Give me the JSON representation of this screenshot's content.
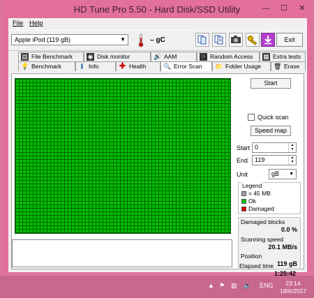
{
  "window": {
    "title": "HD Tune Pro 5.50 - Hard Disk/SSD Utility",
    "minimize": "—",
    "maximize": "☐",
    "close": "✕"
  },
  "menu": {
    "file": "File",
    "help": "Help"
  },
  "toolbar": {
    "drive": "Apple   iPod (119 gB)",
    "temperature": "– gC",
    "exit_label": "Exit"
  },
  "tabs": {
    "row1": [
      {
        "label": "File Benchmark",
        "icon": "file-benchmark-icon"
      },
      {
        "label": "Disk monitor",
        "icon": "disk-monitor-icon"
      },
      {
        "label": "AAM",
        "icon": "speaker-icon"
      },
      {
        "label": "Random Access",
        "icon": "random-access-icon"
      },
      {
        "label": "Extra tests",
        "icon": "extra-tests-icon"
      }
    ],
    "row2": [
      {
        "label": "Benchmark",
        "icon": "benchmark-icon"
      },
      {
        "label": "Info",
        "icon": "info-icon"
      },
      {
        "label": "Health",
        "icon": "health-cross-icon"
      },
      {
        "label": "Error Scan",
        "icon": "magnifier-icon"
      },
      {
        "label": "Folder Usage",
        "icon": "folder-icon"
      },
      {
        "label": "Erase",
        "icon": "trash-icon"
      }
    ]
  },
  "scan": {
    "start_button": "Start",
    "quick_scan": "Quick scan",
    "speed_map": "Speed map",
    "start_label": "Start",
    "start_value": "0",
    "end_label": "End",
    "end_value": "119",
    "unit_label": "Unit",
    "unit_value": "gB",
    "legend_title": "Legend",
    "legend_block": "= 45 MB",
    "legend_ok": "Ok",
    "legend_damaged": "Damaged",
    "ok_color": "#00c000",
    "damaged_color": "#e00000",
    "block_color": "#a0a0a0"
  },
  "stats": {
    "damaged_label": "Damaged blocks",
    "damaged_value": "0.0 %",
    "speed_label": "Scanning speed",
    "speed_value": "20.1 MB/s",
    "position_label": "Position",
    "position_value": "119 gB",
    "elapsed_label": "Elapsed time",
    "elapsed_value": "1:25:42"
  },
  "taskbar": {
    "language": "ENG",
    "time": "23:14",
    "date": "18/6/2557"
  }
}
